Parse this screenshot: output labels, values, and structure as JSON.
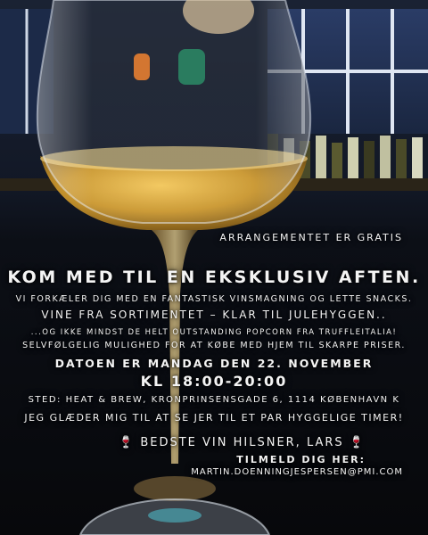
{
  "colors": {
    "background": "#0b0d12",
    "text": "#f4f4f4",
    "wine": "#c9962e"
  },
  "icons": [
    "wine-glass-icon"
  ],
  "poster": {
    "gratis": "ARRANGEMENTET ER GRATIS",
    "headline": "KOM MED TIL EN EKSKLUSIV AFTEN.",
    "line1": "VI FORKÆLER DIG MED EN FANTASTISK VINSMAGNING OG LETTE SNACKS.",
    "line2": "VINE FRA SORTIMENTET – KLAR TIL JULEHYGGEN..",
    "line3": "...OG IKKE MINDST DE HELT OUTSTANDING POPCORN FRA TRUFFLEITALIA!",
    "line4": "SELVFØLGELIG MULIGHED FOR AT KØBE MED HJEM TIL SKARPE PRISER.",
    "date": "DATOEN ER MANDAG DEN 22. NOVEMBER",
    "time": "KL 18:00-20:00",
    "venue": "STED: HEAT & BREW, KRONPRINSENSGADE 6, 1114 KØBENHAVN K",
    "closing": "JEG GLÆDER MIG TIL AT SE JER TIL ET PAR HYGGELIGE TIMER!",
    "signature": "BEDSTE VIN HILSNER,  LARS",
    "signup_label": "TILMELD DIG HER:",
    "email": "MARTIN.DOENNINGJESPERSEN@PMI.COM"
  }
}
